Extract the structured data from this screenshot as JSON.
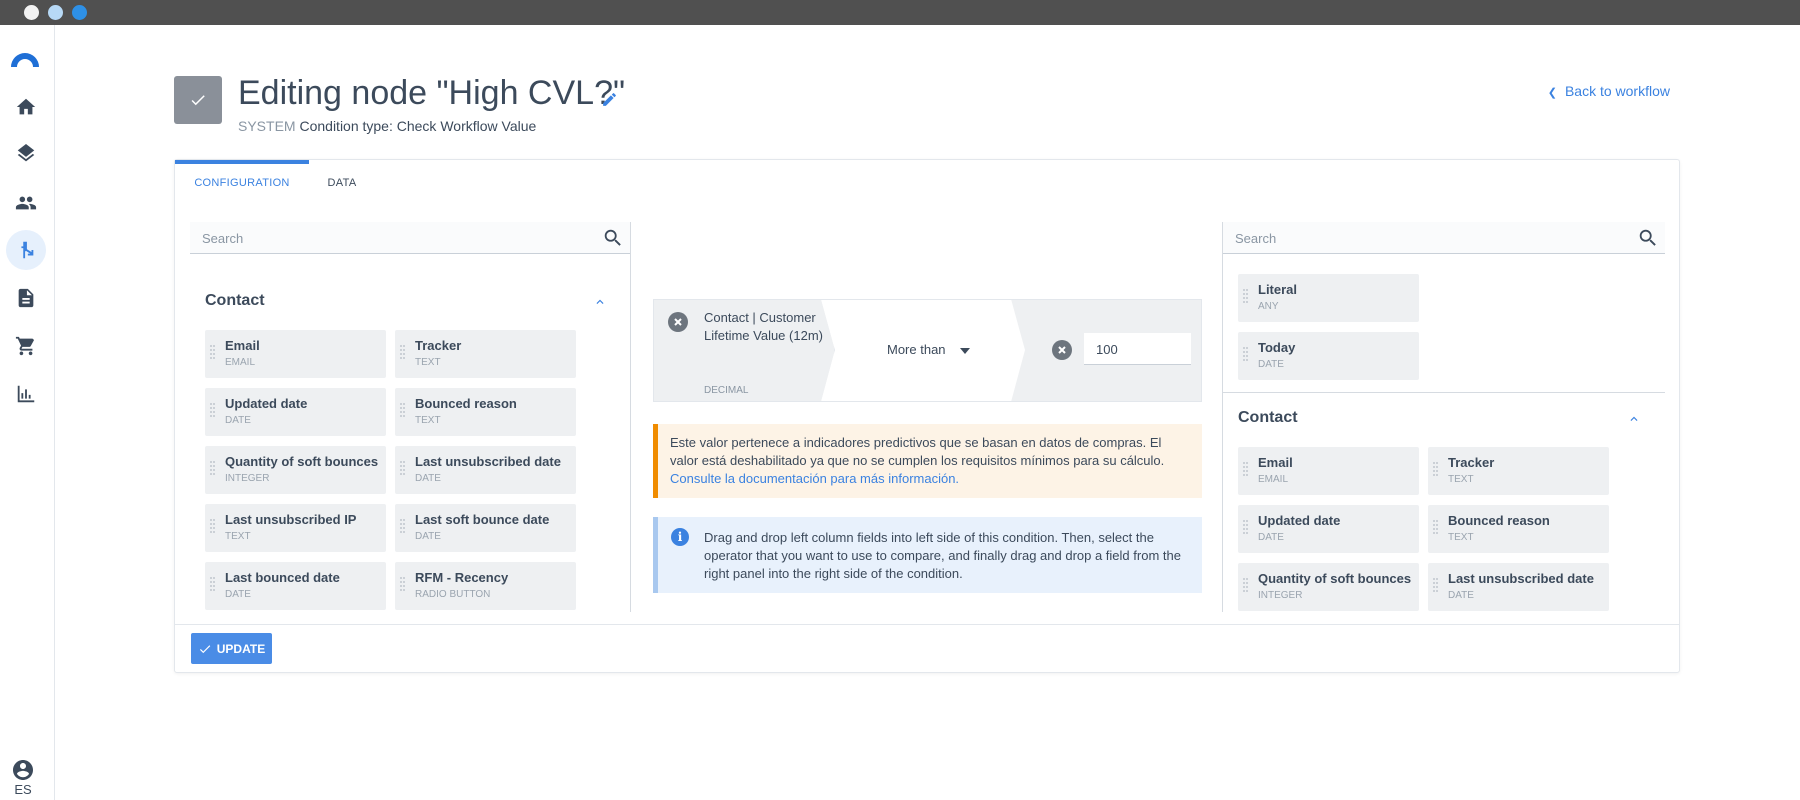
{
  "app": {
    "language": "ES"
  },
  "sidebar": {
    "items": [
      {
        "icon": "home-icon"
      },
      {
        "icon": "layers-icon"
      },
      {
        "icon": "people-icon"
      },
      {
        "icon": "workflow-icon",
        "active": true
      },
      {
        "icon": "document-icon"
      },
      {
        "icon": "cart-icon"
      },
      {
        "icon": "chart-icon"
      }
    ]
  },
  "header": {
    "title": "Editing node \"High CVL?\"",
    "system_label": "SYSTEM",
    "condition_type": "Condition type: Check Workflow Value",
    "back_link": "Back to workflow"
  },
  "tabs": [
    {
      "label": "CONFIGURATION",
      "active": true
    },
    {
      "label": "DATA",
      "active": false
    }
  ],
  "left_panel": {
    "search_placeholder": "Search",
    "section_title": "Contact",
    "fields": [
      {
        "name": "Email",
        "type": "EMAIL"
      },
      {
        "name": "Tracker",
        "type": "TEXT"
      },
      {
        "name": "Updated date",
        "type": "DATE"
      },
      {
        "name": "Bounced reason",
        "type": "TEXT"
      },
      {
        "name": "Quantity of soft bounces",
        "type": "INTEGER"
      },
      {
        "name": "Last unsubscribed date",
        "type": "DATE"
      },
      {
        "name": "Last unsubscribed IP",
        "type": "TEXT"
      },
      {
        "name": "Last soft bounce date",
        "type": "DATE"
      },
      {
        "name": "Last bounced date",
        "type": "DATE"
      },
      {
        "name": "RFM - Recency",
        "type": "RADIO BUTTON"
      }
    ]
  },
  "condition": {
    "field_label": "Contact | Customer Lifetime Value (12m)",
    "field_type": "DECIMAL",
    "operator": "More than",
    "value": "100"
  },
  "alerts": {
    "warning_text": "Este valor pertenece a indicadores predictivos que se basan en datos de compras. El valor está deshabilitado ya que no se cumplen los requisitos mínimos para su cálculo.",
    "warning_link": "Consulte la documentación para más información.",
    "info_text": "Drag and drop left column fields into left side of this condition. Then, select the operator that you want to use to compare, and finally drag and drop a field from the right panel into the right side of the condition."
  },
  "right_panel": {
    "search_placeholder": "Search",
    "literals": [
      {
        "name": "Literal",
        "type": "ANY"
      },
      {
        "name": "Today",
        "type": "DATE"
      }
    ],
    "section_title": "Contact",
    "fields": [
      {
        "name": "Email",
        "type": "EMAIL"
      },
      {
        "name": "Tracker",
        "type": "TEXT"
      },
      {
        "name": "Updated date",
        "type": "DATE"
      },
      {
        "name": "Bounced reason",
        "type": "TEXT"
      },
      {
        "name": "Quantity of soft bounces",
        "type": "INTEGER"
      },
      {
        "name": "Last unsubscribed date",
        "type": "DATE"
      }
    ]
  },
  "footer": {
    "update_label": "UPDATE"
  },
  "colors": {
    "accent": "#3b82e0",
    "warning": "#f08c00",
    "titlebar": "#505050"
  }
}
